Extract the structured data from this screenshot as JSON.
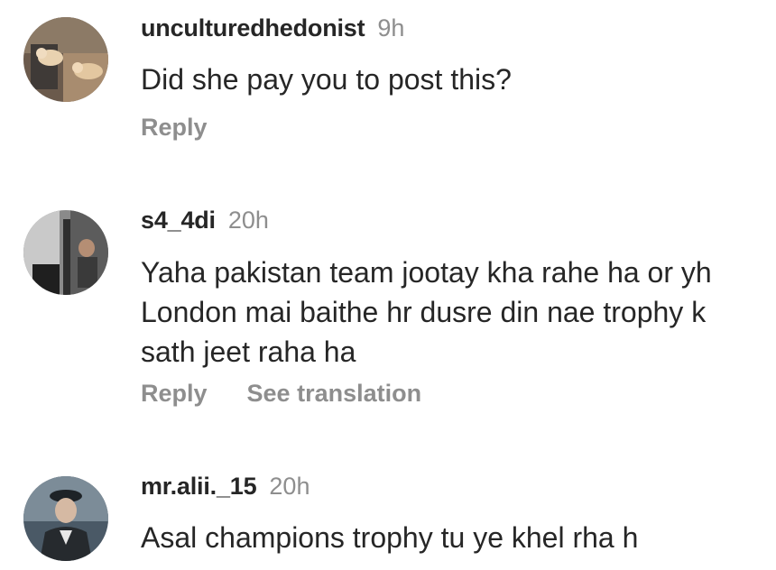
{
  "comments": [
    {
      "avatar_icon": "user-avatar-cats",
      "username": "unculturedhedonist",
      "time": "9h",
      "text": "Did she pay you to post this?",
      "actions": [
        "Reply"
      ]
    },
    {
      "avatar_icon": "user-avatar-street",
      "username": "s4_4di",
      "time": "20h",
      "text": "Yaha pakistan team jootay kha rahe ha or yh London mai baithe hr dusre din nae trophy k sath jeet raha ha",
      "actions": [
        "Reply",
        "See translation"
      ]
    },
    {
      "avatar_icon": "user-avatar-man-cap",
      "username": "mr.alii._15",
      "time": "20h",
      "text": "Asal champions trophy tu ye khel rha h",
      "actions": []
    }
  ],
  "colors": {
    "primary_text": "#262626",
    "secondary_text": "#8e8e8e",
    "background": "#ffffff"
  }
}
